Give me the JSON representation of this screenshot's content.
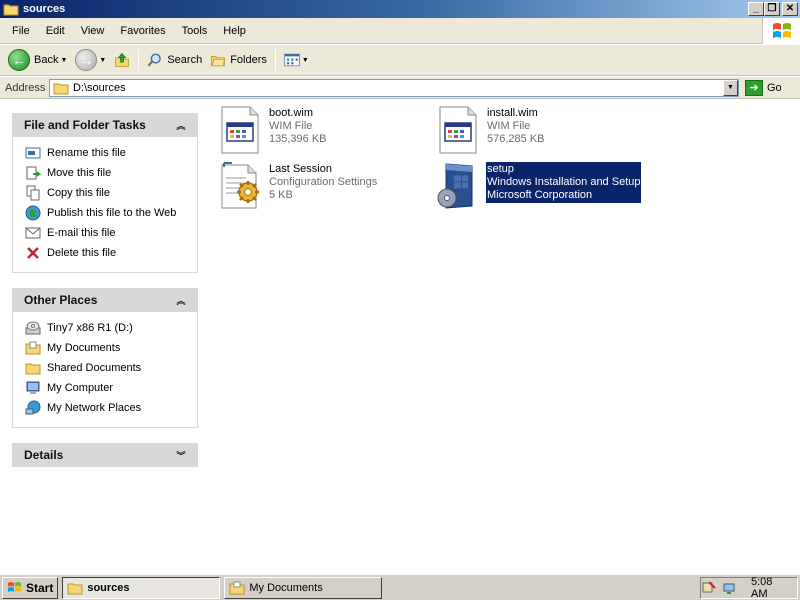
{
  "window": {
    "title": "sources",
    "minimize_glyph": "_",
    "restore_glyph": "❐",
    "close_glyph": "✕"
  },
  "menu": [
    "File",
    "Edit",
    "View",
    "Favorites",
    "Tools",
    "Help"
  ],
  "toolbar": {
    "back_label": "Back",
    "search_label": "Search",
    "folders_label": "Folders"
  },
  "address": {
    "label": "Address",
    "value": "D:\\sources",
    "go_label": "Go"
  },
  "file_tasks": {
    "title": "File and Folder Tasks",
    "items": [
      {
        "label": "Rename this file",
        "icon": "rename-icon"
      },
      {
        "label": "Move this file",
        "icon": "move-icon"
      },
      {
        "label": "Copy this file",
        "icon": "copy-icon"
      },
      {
        "label": "Publish this file to the Web",
        "icon": "publish-web-icon"
      },
      {
        "label": "E-mail this file",
        "icon": "email-icon"
      },
      {
        "label": "Delete this file",
        "icon": "delete-icon"
      }
    ]
  },
  "other_places": {
    "title": "Other Places",
    "items": [
      {
        "label": "Tiny7 x86 R1 (D:)",
        "icon": "cd-drive-icon"
      },
      {
        "label": "My Documents",
        "icon": "my-documents-icon"
      },
      {
        "label": "Shared Documents",
        "icon": "shared-folder-icon"
      },
      {
        "label": "My Computer",
        "icon": "my-computer-icon"
      },
      {
        "label": "My Network Places",
        "icon": "network-places-icon"
      }
    ]
  },
  "details": {
    "title": "Details"
  },
  "files": [
    {
      "name": "boot.wim",
      "type": "WIM File",
      "size": "135,396 KB",
      "icon": "wim-file-icon",
      "selected": false
    },
    {
      "name": "install.wim",
      "type": "WIM File",
      "size": "576,285 KB",
      "icon": "wim-file-icon",
      "selected": false
    },
    {
      "name": "Last Session",
      "type": "Configuration Settings",
      "size": "5 KB",
      "icon": "config-settings-icon",
      "selected": false
    },
    {
      "name": "setup",
      "type": "Windows Installation and Setup",
      "size": "Microsoft Corporation",
      "icon": "setup-app-icon",
      "selected": true
    }
  ],
  "taskbar": {
    "start_label": "Start",
    "items": [
      {
        "label": "sources",
        "active": true
      },
      {
        "label": "My Documents",
        "active": false
      }
    ],
    "clock": "5:08 AM"
  },
  "colors": {
    "selection": "#0a246a",
    "panel_header": "#d8d8d8",
    "chrome": "#ece9d8"
  }
}
